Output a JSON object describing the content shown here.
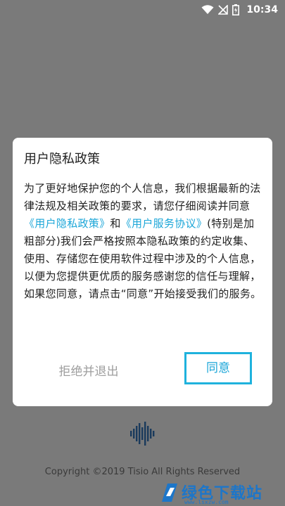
{
  "status_bar": {
    "time": "10:34",
    "icons": [
      "wifi-icon",
      "no-signal-icon",
      "battery-charging-icon"
    ]
  },
  "dialog": {
    "title": "用户隐私政策",
    "body": {
      "part1": "为了更好地保护您的个人信息，我们根据最新的法律法规及相关政策的要求，请您仔细阅读并同意",
      "privacy_link": "《用户隐私政策》",
      "and": "和",
      "service_link": "《用户服务协议》",
      "part2": "(特别是加粗部分)我们会严格按照本隐私政策的约定收集、使用、存储您在使用软件过程中涉及的个人信息，以便为您提供更优质的服务感谢您的信任与理解，如果您同意，请点击“同意”开始接受我们的服务。"
    },
    "buttons": {
      "exit": "拒绝并退出",
      "agree": "同意"
    }
  },
  "footer": {
    "logo_icon": "soundwave-icon",
    "copyright": "Copyright ©2019 Tisio All Rights Reserved"
  },
  "watermark": {
    "text": "绿色下载站",
    "url": "www.lsxzw.com"
  },
  "colors": {
    "overlay": "#7a7a7a",
    "link": "#1ba6d8",
    "highlight_border": "#1fb2dd",
    "muted_button": "#9e9e9e"
  }
}
